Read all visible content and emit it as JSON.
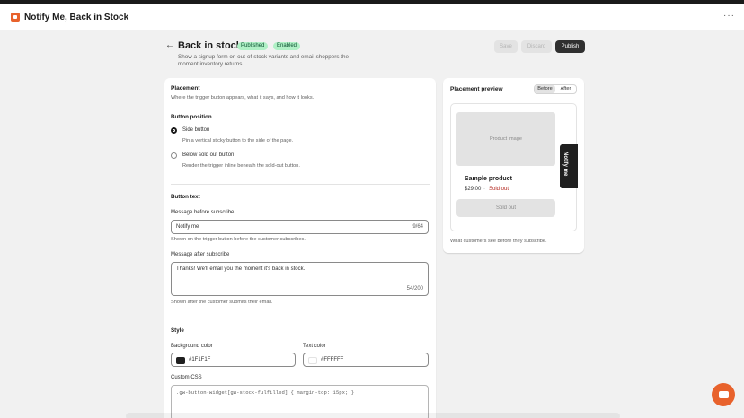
{
  "app": {
    "title": "Notify Me, Back in Stock",
    "icon": "app-logo-icon",
    "menu_icon": "more-horizontal-icon",
    "menu_text": "···"
  },
  "header": {
    "back_icon": "arrow-left-icon",
    "back_text": "←",
    "title": "Back in stock",
    "badges": [
      "Published",
      "Enabled"
    ],
    "subtitle": "Show a signup form on out-of-stock variants and email shoppers the moment inventory returns.",
    "actions": {
      "save": "Save",
      "discard": "Discard",
      "publish": "Publish"
    }
  },
  "placement": {
    "heading": "Placement",
    "description": "Where the trigger button appears, what it says, and how it looks.",
    "button_position": {
      "heading": "Button position",
      "options": [
        {
          "label": "Side button",
          "help": "Pin a vertical sticky button to the side of the page.",
          "selected": true
        },
        {
          "label": "Below sold out button",
          "help": "Render the trigger inline beneath the sold-out button.",
          "selected": false
        }
      ]
    },
    "button_text": {
      "heading": "Button text",
      "before": {
        "label": "Message before subscribe",
        "value": "Notify me",
        "count": "9/64",
        "help": "Shown on the trigger button before the customer subscribes."
      },
      "after": {
        "label": "Message after subscribe",
        "value": "Thanks! We'll email you the moment it's back in stock.",
        "count": "54/200",
        "help": "Shown after the customer submits their email."
      }
    },
    "style": {
      "heading": "Style",
      "background": {
        "label": "Background color",
        "value": "#1F1F1F"
      },
      "text": {
        "label": "Text color",
        "value": "#FFFFFF"
      },
      "custom_css": {
        "label": "Custom CSS",
        "value": ".gw-button-widget[gw-stock-fulfilled] { margin-top: 15px; }"
      }
    }
  },
  "preview": {
    "heading": "Placement preview",
    "toggle": [
      "Before",
      "After"
    ],
    "active_toggle": "Before",
    "product_image": "Product image",
    "product_name": "Sample product",
    "price": "$29.00",
    "separator": "·",
    "status": "Sold out",
    "side_button": "Notify me",
    "sold_out_button": "Sold out",
    "caption": "What customers see before they subscribe."
  },
  "chat": {
    "icon": "chat-bubble-icon"
  },
  "colors": {
    "accent": "#e8622c",
    "badge_bg": "#aff0c5",
    "badge_text": "#0c5132",
    "sold_out": "#b3261e"
  }
}
